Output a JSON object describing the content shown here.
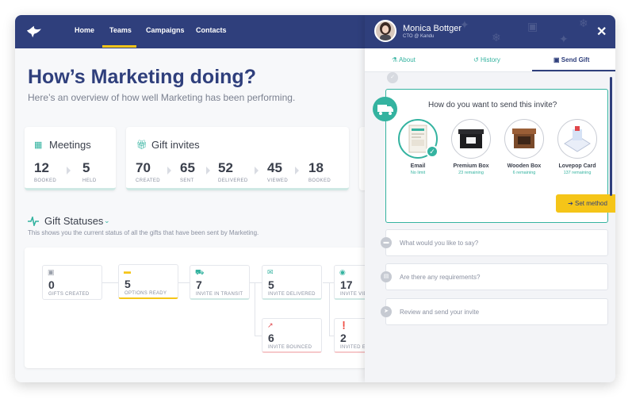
{
  "nav": {
    "items": [
      "Home",
      "Teams",
      "Campaigns",
      "Contacts"
    ]
  },
  "main": {
    "title": "How’s Marketing doing?",
    "subtitle": "Here’s an overview of how well Marketing has been performing.",
    "meetings": {
      "title": "Meetings",
      "metrics": [
        {
          "value": "12",
          "label": "BOOKED"
        },
        {
          "value": "5",
          "label": "HELD"
        }
      ]
    },
    "gift_invites": {
      "title": "Gift invites",
      "metrics": [
        {
          "value": "70",
          "label": "CREATED"
        },
        {
          "value": "65",
          "label": "SENT"
        },
        {
          "value": "52",
          "label": "DELIVERED"
        },
        {
          "value": "45",
          "label": "VIEWED"
        },
        {
          "value": "18",
          "label": "BOOKED"
        }
      ]
    },
    "gift_statuses": {
      "title": "Gift Statuses",
      "subtitle": "This shows you the current status of all the gifts that have been sent by Marketing.",
      "nodes": [
        {
          "value": "0",
          "label": "GIFTS CREATED",
          "icon": "gift-icon",
          "color": "#9aa0ab"
        },
        {
          "value": "5",
          "label": "OPTIONS READY",
          "icon": "chat-icon",
          "color": "#f5c518"
        },
        {
          "value": "7",
          "label": "INVITE IN TRANSIT",
          "icon": "truck-icon",
          "color": "#34b3a0"
        },
        {
          "value": "5",
          "label": "INVITE DELIVERED",
          "icon": "envelope-icon",
          "color": "#34b3a0"
        },
        {
          "value": "17",
          "label": "INVITE VIEWED",
          "icon": "eye-icon",
          "color": "#34b3a0"
        },
        {
          "value": "6",
          "label": "INVITE BOUNCED",
          "icon": "bounce-arrow-icon",
          "color": "#e0464b"
        },
        {
          "value": "2",
          "label": "INVITED EXPIRED",
          "icon": "alert-icon",
          "color": "#e0464b"
        }
      ]
    }
  },
  "panel": {
    "name": "Monica Bottger",
    "role": "CTO @ Kandu",
    "tabs": [
      "About",
      "History",
      "Send Gift"
    ],
    "question": "How do you want to send this invite?",
    "options": [
      {
        "name": "Email",
        "sub": "No limit"
      },
      {
        "name": "Premium Box",
        "sub": "23 remaining"
      },
      {
        "name": "Wooden Box",
        "sub": "6 remaining"
      },
      {
        "name": "Lovepop Card",
        "sub": "137 remaining"
      }
    ],
    "set_button": "Set method",
    "steps": [
      "What would you like to say?",
      "Are there any requirements?",
      "Review and send your invite"
    ],
    "colors": {
      "brand": "#2f3f7c",
      "accent": "#34b3a0",
      "button": "#f5c518",
      "alert": "#e0464b"
    }
  }
}
